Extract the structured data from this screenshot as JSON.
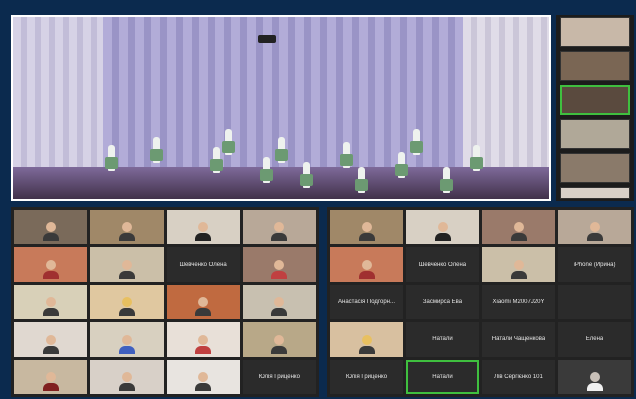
{
  "colors": {
    "background": "#0b2a4e",
    "active_speaker": "#3fbf3f",
    "tile": "#2b2b2b"
  },
  "left_grid": {
    "names": {
      "r2c3": "Шевченко Олена",
      "r5c4": "Юлія Гриценко"
    }
  },
  "right_grid": {
    "names": {
      "r2c2": "Шевченко Олена",
      "r2c4": "iPhone (Ирина)",
      "r3c1": "Анастасія Подгорн...",
      "r3c2": "Засмирса Ева",
      "r3c3": "Xiaomi M2007J20Y",
      "r4c2": "Натали",
      "r4c3": "Натали Чащенкова",
      "r4c4": "Елена",
      "r5c1": "Юлія Гриценко",
      "r5c2": "Натали",
      "r5c3": "Лів Сергієнко 101"
    }
  }
}
